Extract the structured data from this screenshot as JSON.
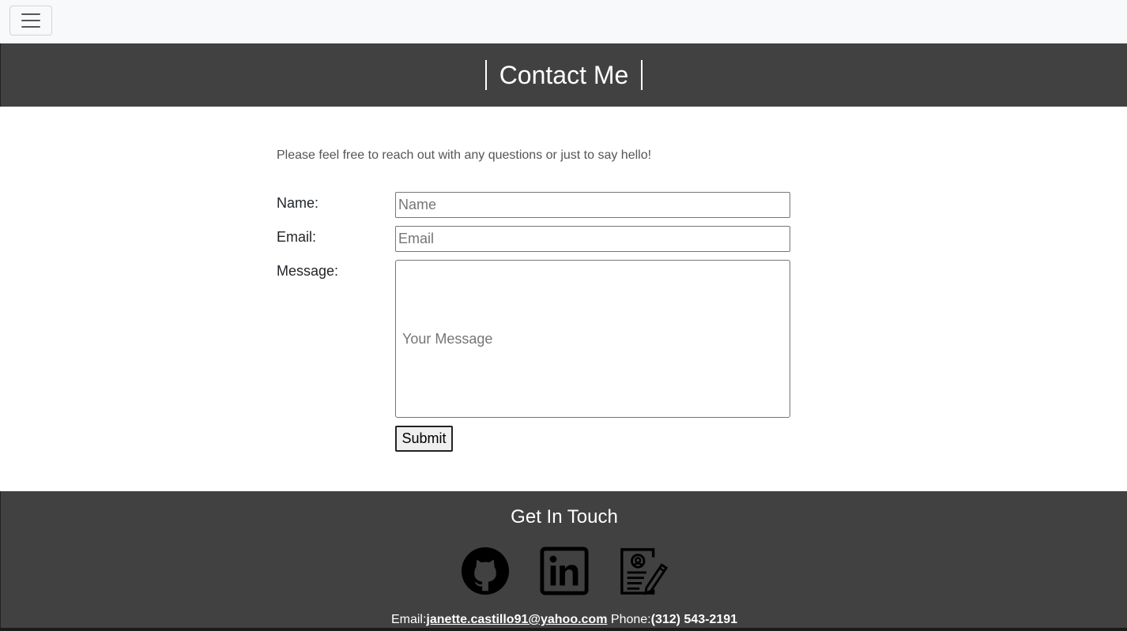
{
  "nav": {
    "toggler_icon": "hamburger-menu-icon"
  },
  "header": {
    "title": "Contact Me"
  },
  "intro": "Please feel free to reach out with any questions or just to say hello!",
  "form": {
    "name_label": "Name:",
    "name_placeholder": "Name",
    "email_label": "Email:",
    "email_placeholder": "Email",
    "message_label": "Message:",
    "message_placeholder": "Your Message",
    "submit_label": "Submit"
  },
  "footer": {
    "title": "Get In Touch",
    "icons": [
      "github-icon",
      "linkedin-icon",
      "resume-icon"
    ],
    "email_label": "Email:",
    "email": "janette.castillo91@yahoo.com",
    "phone_label": "Phone:",
    "phone": "(312) 543-2191"
  },
  "colors": {
    "nav_bg": "#f8f9fa",
    "header_bg": "#414141",
    "footer_bg": "#414141",
    "text_white": "#ffffff"
  }
}
